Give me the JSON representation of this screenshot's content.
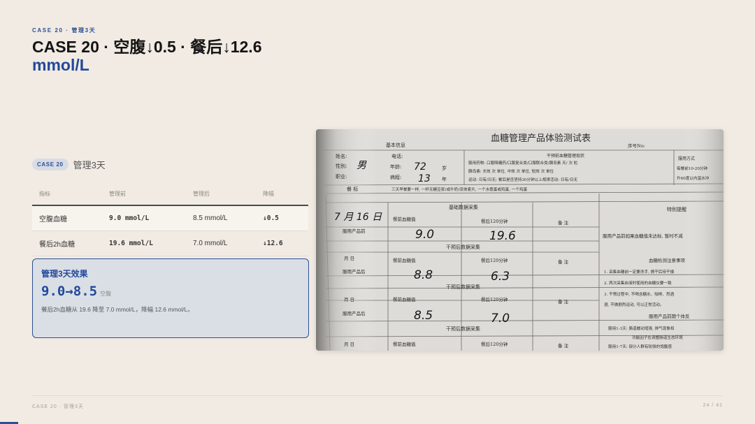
{
  "header": {
    "eyebrow": "CASE 20 · 管理3天",
    "title_main": "CASE 20 · 空腹↓0.5 · 餐后↓12.6",
    "title_accent": "mmol/L"
  },
  "case_tag": {
    "pill": "CASE 20",
    "subtitle": "管理3天"
  },
  "table": {
    "headers": [
      "指标",
      "管理前",
      "管理后",
      "降幅"
    ],
    "rows": [
      {
        "metric": "空腹血糖",
        "before": "9.0 mmol/L",
        "after": "8.5 mmol/L",
        "delta": "↓0.5"
      },
      {
        "metric": "餐后2h血糖",
        "before": "19.6 mmol/L",
        "after": "7.0 mmol/L",
        "delta": "↓12.6"
      }
    ]
  },
  "effect": {
    "title": "管理3天效果",
    "value": "9.0→8.5",
    "unit": "空腹",
    "desc": "餐后2h血糖从 19.6 降至 7.0 mmol/L，降幅 12.6 mmol/L。"
  },
  "photo": {
    "form_title": "血糖管理产品体验测试表",
    "serial_label": "序号No:",
    "basic_info": "基本信息",
    "name_label": "姓名:",
    "phone_label": "电话:",
    "gender_label": "性别:",
    "gender_value": "男",
    "age_label": "年龄:",
    "age_value": "72",
    "age_unit": "岁",
    "job_label": "职业:",
    "course_label": "病程:",
    "course_value": "13",
    "course_unit": "年",
    "pre_use_status": "干预前血糖管理现状",
    "med_line": "服用药物: 口服降糖药/口服复合类/口服联合类/胰岛素  天/  次  粒",
    "insulin_line": "胰岛素: 长效   次   单位, 中效   次   单位, 短效   次   单位",
    "exercise_line": "运动: 日有/日无; 餐后是否坚持30分钟以上规律活动: 日有/日无",
    "meal_label": "餐    标",
    "meal_line": "三天早餐要一样, 一杯无糖豆浆(或牛奶)流体麦片, 一个水煮蛋或鸡蛋, 一个鸡蛋",
    "baseline_section": "基础数据采集",
    "date_label": "月    日",
    "date_value": "7 月 16 日",
    "fasting_label": "餐前血糖值",
    "post_label": "餐后120分钟",
    "remark_label": "备  注",
    "row1_label": "服用产品前",
    "row1_fasting": "9.0",
    "row1_post": "19.6",
    "section2": "干预后数据采集",
    "row2_label": "服用产品后",
    "row2_fasting": "8.8",
    "row2_post": "6.3",
    "section3": "干预后数据采集",
    "row3_label": "服用产品后",
    "row3_fasting": "8.5",
    "row3_post": "7.0",
    "section4": "干预后数据采集",
    "special_reminder": "特别提醒",
    "reminder_text": "服用产品前如果血糖值未达标, 暂时不减",
    "test_notes": "血糖检测注意事项",
    "note1": "1. 采集血糖前一定要洗手, 擦干后待干燥",
    "note2": "2. 两次采集血液时使用的血糖仪要一致",
    "note3": "3. 干预过程中, 不喝含糖水、咖啡、烈酒",
    "note4": "酒, 不做剧烈运动, 可以正常活动。",
    "early_reaction": "服用产品前期个体反",
    "reaction1": "服用1-3天: 肠道蠕动增强, 排气现象和",
    "reaction2": "功能因子在调整肠道生态环境",
    "reaction3": "服用1-7天: 部分人群有较强的饱腹感",
    "right_col_top": "服用方式",
    "right_col_line1": "每餐前10-20分钟",
    "right_col_line2": "升60度以内温水冲"
  },
  "footer": {
    "left": "CASE 20 · 管理3天",
    "right": "24 / 41"
  },
  "progress": {
    "current": 24,
    "total": 41
  },
  "colors": {
    "accent": "#23489b",
    "background": "#f1ebe3",
    "down": "#2f8a4c"
  }
}
